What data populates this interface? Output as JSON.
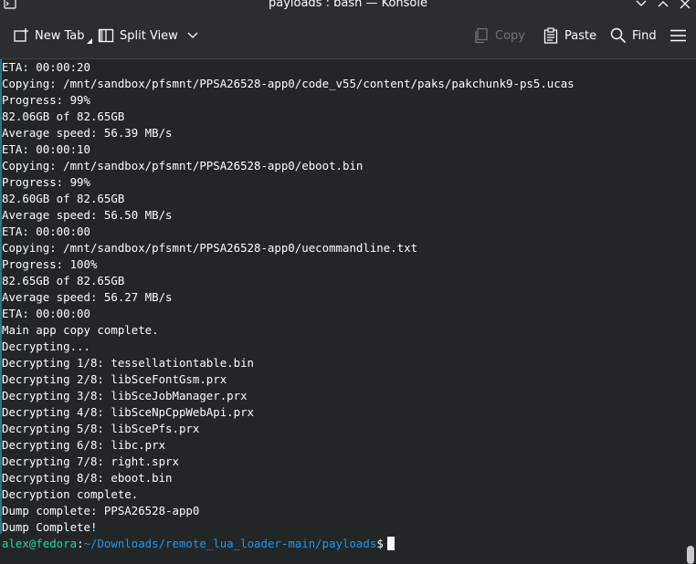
{
  "window": {
    "title": "payloads : bash — Konsole"
  },
  "toolbar": {
    "new_tab": "New Tab",
    "split_view": "Split View",
    "copy": "Copy",
    "paste": "Paste",
    "find": "Find"
  },
  "terminal": {
    "lines": [
      "ETA: 00:00:20",
      "Copying: /mnt/sandbox/pfsmnt/PPSA26528-app0/code_v55/content/paks/pakchunk9-ps5.ucas",
      "Progress: 99%",
      "82.06GB of 82.65GB",
      "Average speed: 56.39 MB/s",
      "ETA: 00:00:10",
      "Copying: /mnt/sandbox/pfsmnt/PPSA26528-app0/eboot.bin",
      "Progress: 99%",
      "82.60GB of 82.65GB",
      "Average speed: 56.50 MB/s",
      "ETA: 00:00:00",
      "Copying: /mnt/sandbox/pfsmnt/PPSA26528-app0/uecommandline.txt",
      "Progress: 100%",
      "82.65GB of 82.65GB",
      "Average speed: 56.27 MB/s",
      "ETA: 00:00:00",
      "Main app copy complete.",
      "Decrypting...",
      "Decrypting 1/8: tessellationtable.bin",
      "Decrypting 2/8: libSceFontGsm.prx",
      "Decrypting 3/8: libSceJobManager.prx",
      "Decrypting 4/8: libSceNpCppWebApi.prx",
      "Decrypting 5/8: libScePfs.prx",
      "Decrypting 6/8: libc.prx",
      "Decrypting 7/8: right.sprx",
      "Decrypting 8/8: eboot.bin",
      "Decryption complete.",
      "Dump complete: PPSA26528-app0",
      "Dump Complete!"
    ],
    "prompt": {
      "user_host": "alex@fedora",
      "separator": ":",
      "path": "~/Downloads/remote_lua_loader-main/payloads",
      "symbol": "$"
    }
  },
  "colors": {
    "background": "#232627",
    "text": "#fcfcfc",
    "prompt_user": "#1cdc9a",
    "prompt_path": "#1d99f3"
  }
}
